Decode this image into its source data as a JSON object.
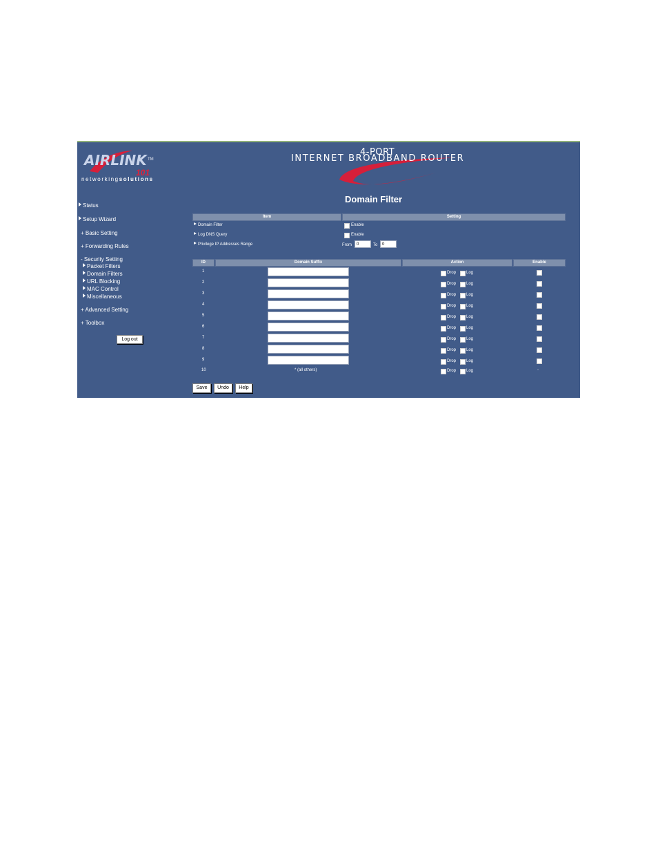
{
  "brand": {
    "logo_text": "AIRLINK",
    "logo_number": "101",
    "logo_tm": "TM",
    "tagline_a": "networking",
    "tagline_b": "solutions",
    "header_top": "4-PORT",
    "header_main": "INTERNET BROADBAND ROUTER"
  },
  "sidebar": {
    "items": [
      {
        "label": "Status",
        "prefix": "arrow"
      },
      {
        "label": "Setup Wizard",
        "prefix": "arrow"
      },
      {
        "label": "+ Basic Setting",
        "prefix": "none"
      },
      {
        "label": "+ Forwarding Rules",
        "prefix": "none"
      },
      {
        "label": "- Security Setting",
        "prefix": "none"
      }
    ],
    "sub_items": [
      {
        "label": "Packet Filters"
      },
      {
        "label": "Domain Filters"
      },
      {
        "label": "URL Blocking"
      },
      {
        "label": "MAC Control"
      },
      {
        "label": "Miscellaneous"
      }
    ],
    "bottom_items": [
      {
        "label": "+ Advanced Setting"
      },
      {
        "label": "+ Toolbox"
      }
    ],
    "logout_label": "Log out"
  },
  "main": {
    "title": "Domain Filter",
    "settings_header": {
      "item": "Item",
      "setting": "Setting"
    },
    "settings": {
      "domain_filter": {
        "label": "Domain Filter",
        "enable_label": "Enable"
      },
      "log_dns": {
        "label": "Log DNS Query",
        "enable_label": "Enable"
      },
      "privilege": {
        "label": "Privilege IP Addresses Range",
        "from_label": "From",
        "from_value": "0",
        "to_label": "To",
        "to_value": "0"
      }
    },
    "rules_header": {
      "id": "ID",
      "suffix": "Domain Suffix",
      "action": "Action",
      "enable": "Enable"
    },
    "rules": [
      {
        "id": "1"
      },
      {
        "id": "2"
      },
      {
        "id": "3"
      },
      {
        "id": "4"
      },
      {
        "id": "5"
      },
      {
        "id": "6"
      },
      {
        "id": "7"
      },
      {
        "id": "8"
      },
      {
        "id": "9"
      }
    ],
    "last_rule": {
      "id": "10",
      "suffix": "* (all others)",
      "enable": "-"
    },
    "action_labels": {
      "drop": "Drop",
      "log": "Log"
    },
    "buttons": {
      "save": "Save",
      "undo": "Undo",
      "help": "Help"
    }
  }
}
